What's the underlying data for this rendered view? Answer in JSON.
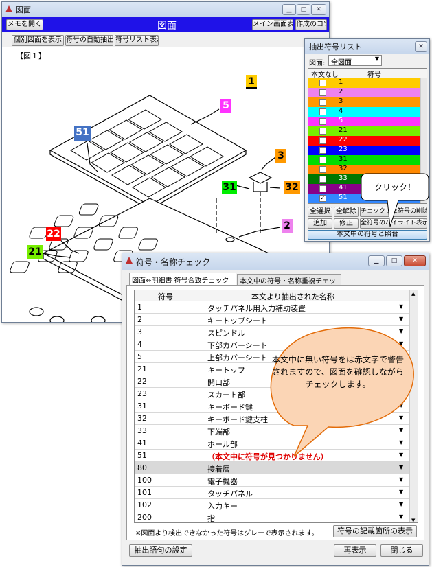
{
  "main_window": {
    "title": "図面",
    "header_title": "図面",
    "memo_button": "メモを開く",
    "main_screen_button": "メイン画面表示",
    "tips_button": "作成のコツ",
    "tabs": [
      "個別図面を表示",
      "符号の自動抽出",
      "符号リスト表示"
    ],
    "figure_label": "【図１】"
  },
  "drawing_labels": [
    "1",
    "5",
    "51",
    "3",
    "31",
    "32",
    "2",
    "22",
    "21"
  ],
  "list_window": {
    "title": "抽出符号リスト",
    "filter_label": "図面:",
    "filter_value": "全図面",
    "col_none": "本文なし",
    "col_symbol": "符号",
    "rows": [
      {
        "symbol": "1",
        "checked": false,
        "color": "#ffcc00",
        "text_color": "#000"
      },
      {
        "symbol": "2",
        "checked": false,
        "color": "#ee82ee",
        "text_color": "#000"
      },
      {
        "symbol": "3",
        "checked": false,
        "color": "#ff9900",
        "text_color": "#000"
      },
      {
        "symbol": "4",
        "checked": false,
        "color": "#00ffff",
        "text_color": "#000"
      },
      {
        "symbol": "5",
        "checked": false,
        "color": "#ff33ff",
        "text_color": "#fff"
      },
      {
        "symbol": "21",
        "checked": false,
        "color": "#77ee00",
        "text_color": "#000"
      },
      {
        "symbol": "22",
        "checked": false,
        "color": "#ff0000",
        "text_color": "#fff"
      },
      {
        "symbol": "23",
        "checked": false,
        "color": "#0000ff",
        "text_color": "#fff"
      },
      {
        "symbol": "31",
        "checked": false,
        "color": "#00dd00",
        "text_color": "#000"
      },
      {
        "symbol": "32",
        "checked": false,
        "color": "#ff8800",
        "text_color": "#000"
      },
      {
        "symbol": "33",
        "checked": false,
        "color": "#007700",
        "text_color": "#fff"
      },
      {
        "symbol": "41",
        "checked": false,
        "color": "#880088",
        "text_color": "#fff"
      },
      {
        "symbol": "51",
        "checked": true,
        "color": "#3388ff",
        "text_color": "#fff"
      }
    ],
    "buttons_row1": [
      "全選択",
      "全解除",
      "チェックした符号の削除"
    ],
    "buttons_row2": [
      "追加",
      "修正",
      "全符号のハイライト表示"
    ],
    "compare_button": "本文中の符号と照合"
  },
  "callout_click": "クリック！",
  "check_window": {
    "title": "符号・名称チェック",
    "tabs": [
      "図面⇔明細書 符号合致チェック",
      "本文中の符号・名称重複チェック"
    ],
    "col_symbol": "符号",
    "col_name": "本文より抽出された名称",
    "rows": [
      {
        "symbol": "1",
        "name": "タッチパネル用入力補助装置",
        "status": "normal"
      },
      {
        "symbol": "2",
        "name": "キートップシート",
        "status": "normal"
      },
      {
        "symbol": "3",
        "name": "スピンドル",
        "status": "normal"
      },
      {
        "symbol": "4",
        "name": "下部カバーシート",
        "status": "normal"
      },
      {
        "symbol": "5",
        "name": "上部カバーシート",
        "status": "normal"
      },
      {
        "symbol": "21",
        "name": "キートップ",
        "status": "normal"
      },
      {
        "symbol": "22",
        "name": "開口部",
        "status": "normal"
      },
      {
        "symbol": "23",
        "name": "スカート部",
        "status": "normal"
      },
      {
        "symbol": "31",
        "name": "キーボード鍵",
        "status": "normal"
      },
      {
        "symbol": "32",
        "name": "キーボード鍵支柱",
        "status": "normal"
      },
      {
        "symbol": "33",
        "name": "下端部",
        "status": "normal"
      },
      {
        "symbol": "41",
        "name": "ホール部",
        "status": "normal"
      },
      {
        "symbol": "51",
        "name": "（本文中に符号が見つかりません）",
        "status": "error"
      },
      {
        "symbol": "80",
        "name": "接着層",
        "status": "gray"
      },
      {
        "symbol": "100",
        "name": "電子機器",
        "status": "normal"
      },
      {
        "symbol": "101",
        "name": "タッチパネル",
        "status": "normal"
      },
      {
        "symbol": "102",
        "name": "入力キー",
        "status": "normal"
      },
      {
        "symbol": "200",
        "name": "指",
        "status": "normal"
      }
    ],
    "footnote": "※図面より検出できなかった符号はグレーで表示されます。",
    "locations_button": "符号の記載箇所の表示",
    "settings_button": "抽出語句の設定",
    "redisplay_button": "再表示",
    "close_button": "閉じる"
  },
  "callout_main": "本文中に無い符号をは赤文字で警告されますので、図面を確認しながらチェックします。"
}
